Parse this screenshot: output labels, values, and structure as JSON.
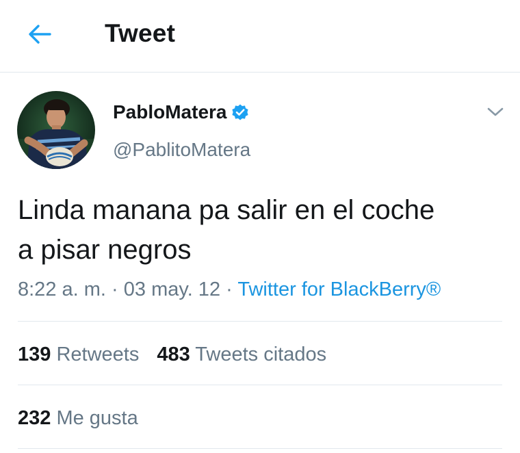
{
  "header": {
    "title": "Tweet",
    "back_icon": "arrow-left-icon",
    "accent_color": "#1da1f2"
  },
  "author": {
    "display_name": "PabloMatera",
    "handle": "@PablitoMatera",
    "verified": true,
    "avatar_icon": "profile-photo"
  },
  "tweet": {
    "text_line1": "Linda manana pa salir en el coche",
    "text_line2": "a pisar negros",
    "time": "8:22 a. m.",
    "separator1": " · ",
    "date": "03 may. 12",
    "separator2": " · ",
    "source": "Twitter for BlackBerry®"
  },
  "stats": {
    "retweets_count": "139",
    "retweets_label": "Retweets",
    "quotes_count": "483",
    "quotes_label": "Tweets citados",
    "likes_count": "232",
    "likes_label": "Me gusta"
  },
  "colors": {
    "link": "#1b95e0",
    "muted": "#657786",
    "divider": "#e1e8ed",
    "text": "#14171a"
  }
}
